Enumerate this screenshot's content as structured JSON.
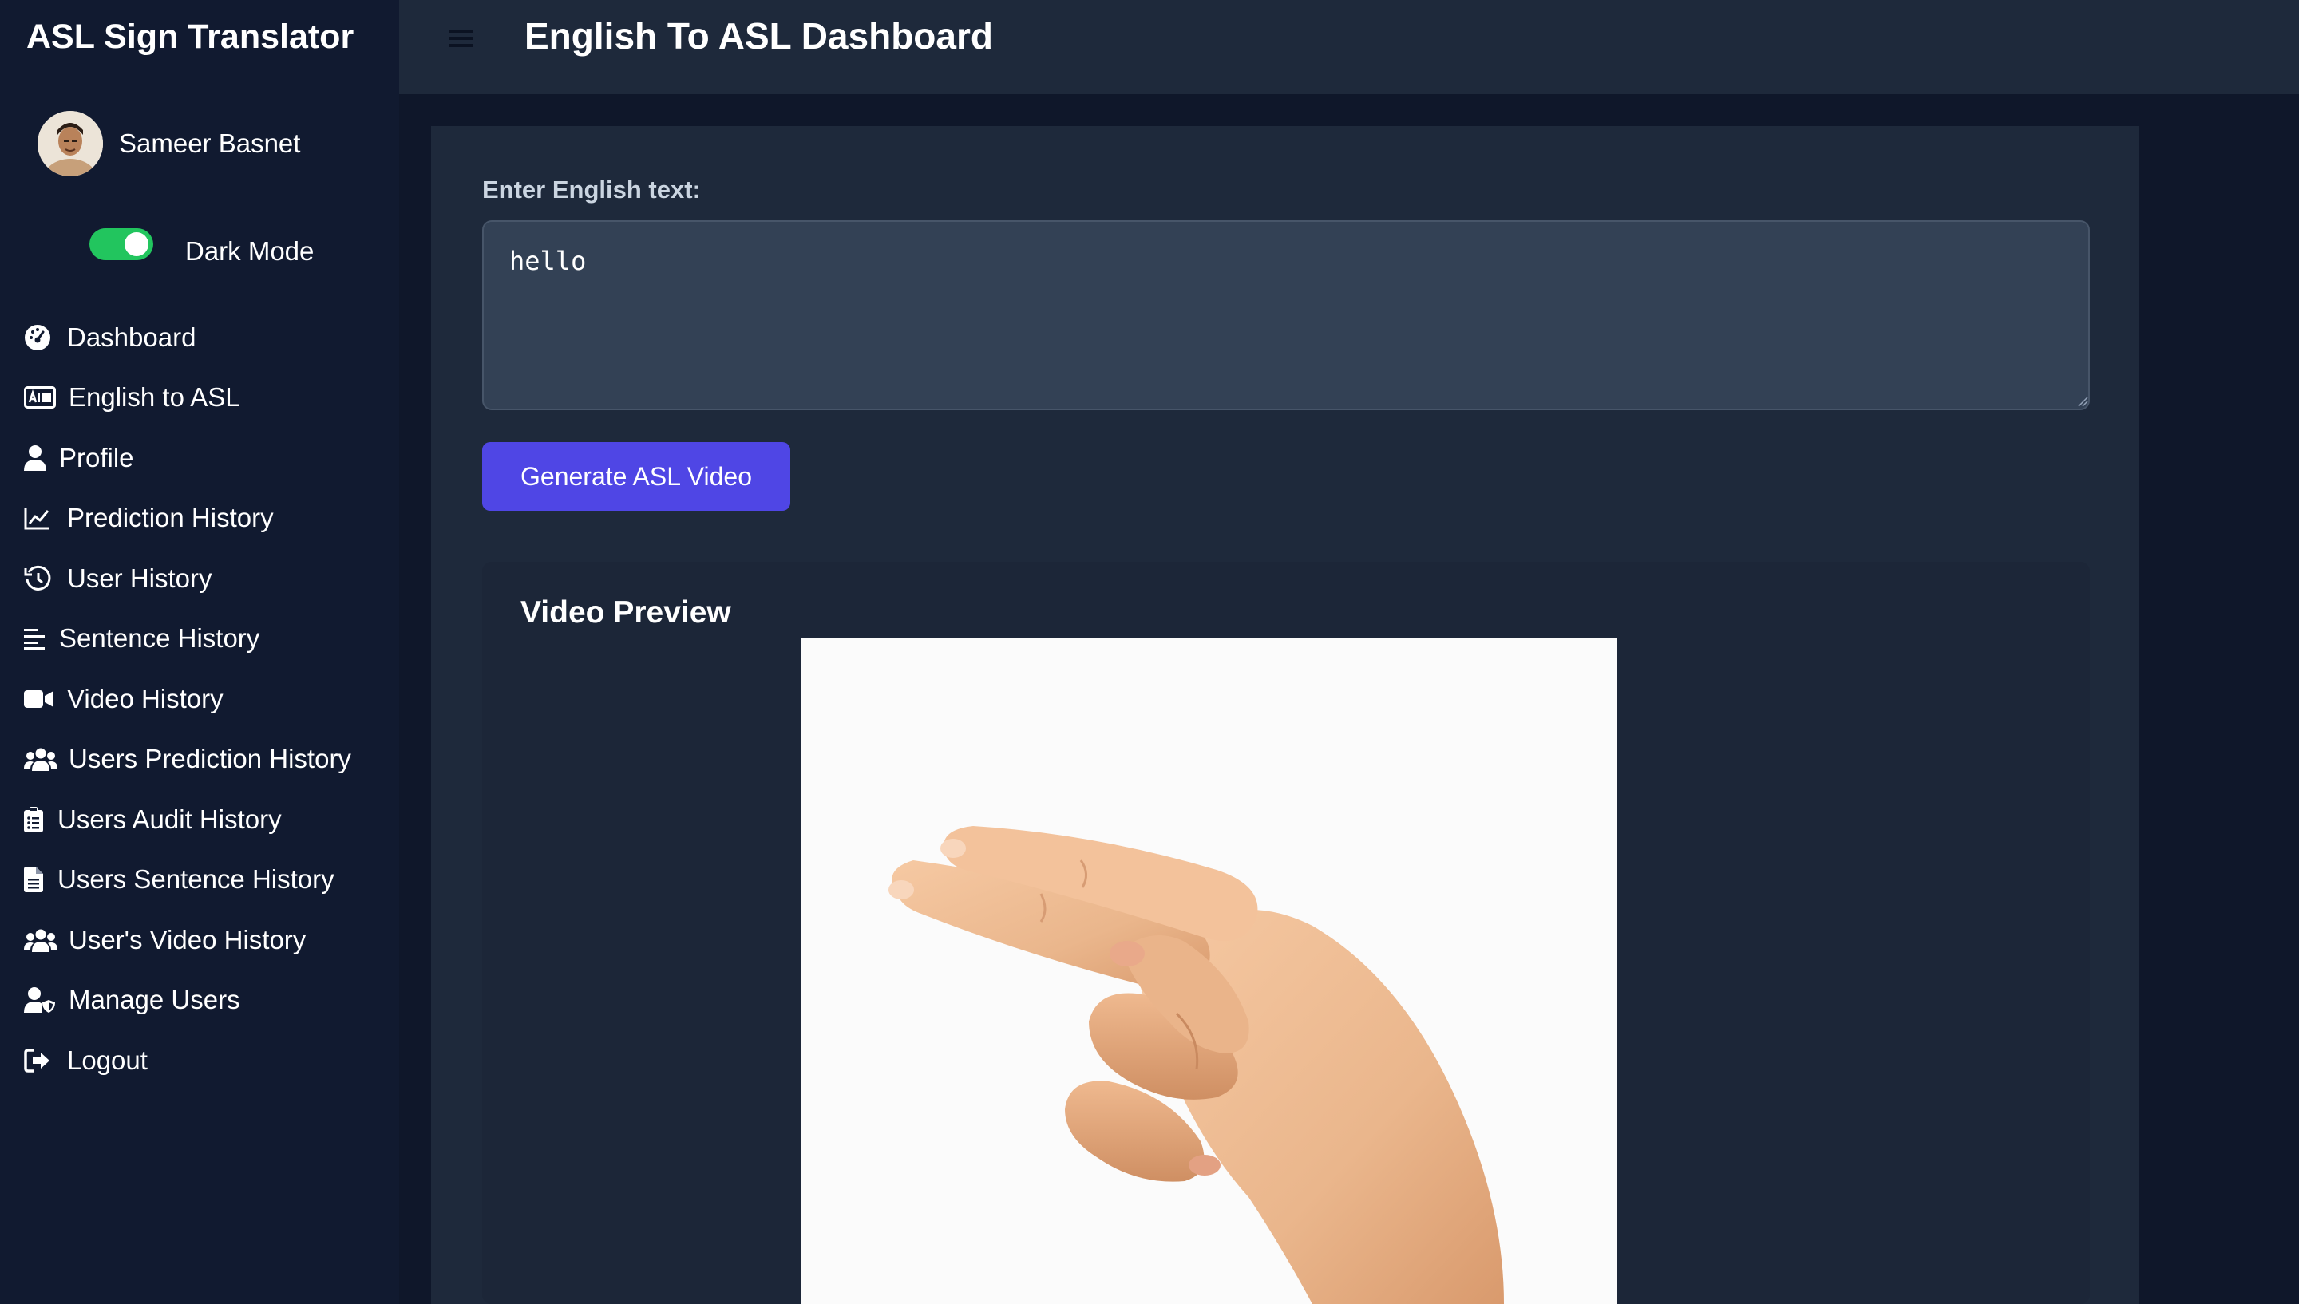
{
  "app": {
    "brand": "ASL Sign Translator"
  },
  "user": {
    "name": "Sameer Basnet",
    "avatar_icon": "user-avatar-photo"
  },
  "theme": {
    "dark_mode_label": "Dark Mode",
    "dark_mode_on": true,
    "toggle_color": "#22c55e"
  },
  "sidebar": {
    "items": [
      {
        "label": "Dashboard",
        "icon": "dashboard-gauge-icon"
      },
      {
        "label": "English to ASL",
        "icon": "translate-card-icon"
      },
      {
        "label": "Profile",
        "icon": "user-icon"
      },
      {
        "label": "Prediction History",
        "icon": "line-chart-icon"
      },
      {
        "label": "User History",
        "icon": "history-clock-icon"
      },
      {
        "label": "Sentence History",
        "icon": "align-left-icon"
      },
      {
        "label": "Video History",
        "icon": "video-camera-icon"
      },
      {
        "label": "Users Prediction History",
        "icon": "users-group-icon"
      },
      {
        "label": "Users Audit History",
        "icon": "clipboard-list-icon"
      },
      {
        "label": "Users Sentence History",
        "icon": "file-text-icon"
      },
      {
        "label": "User's Video History",
        "icon": "users-group-icon"
      },
      {
        "label": "Manage Users",
        "icon": "user-shield-icon"
      },
      {
        "label": "Logout",
        "icon": "logout-icon"
      }
    ]
  },
  "header": {
    "title": "English To ASL Dashboard",
    "menu_icon": "hamburger-menu-icon"
  },
  "form": {
    "label": "Enter English text:",
    "value": "hello",
    "button_label": "Generate ASL Video",
    "button_color": "#4f46e5"
  },
  "preview": {
    "title": "Video Preview",
    "content": "hand-sign-image"
  }
}
